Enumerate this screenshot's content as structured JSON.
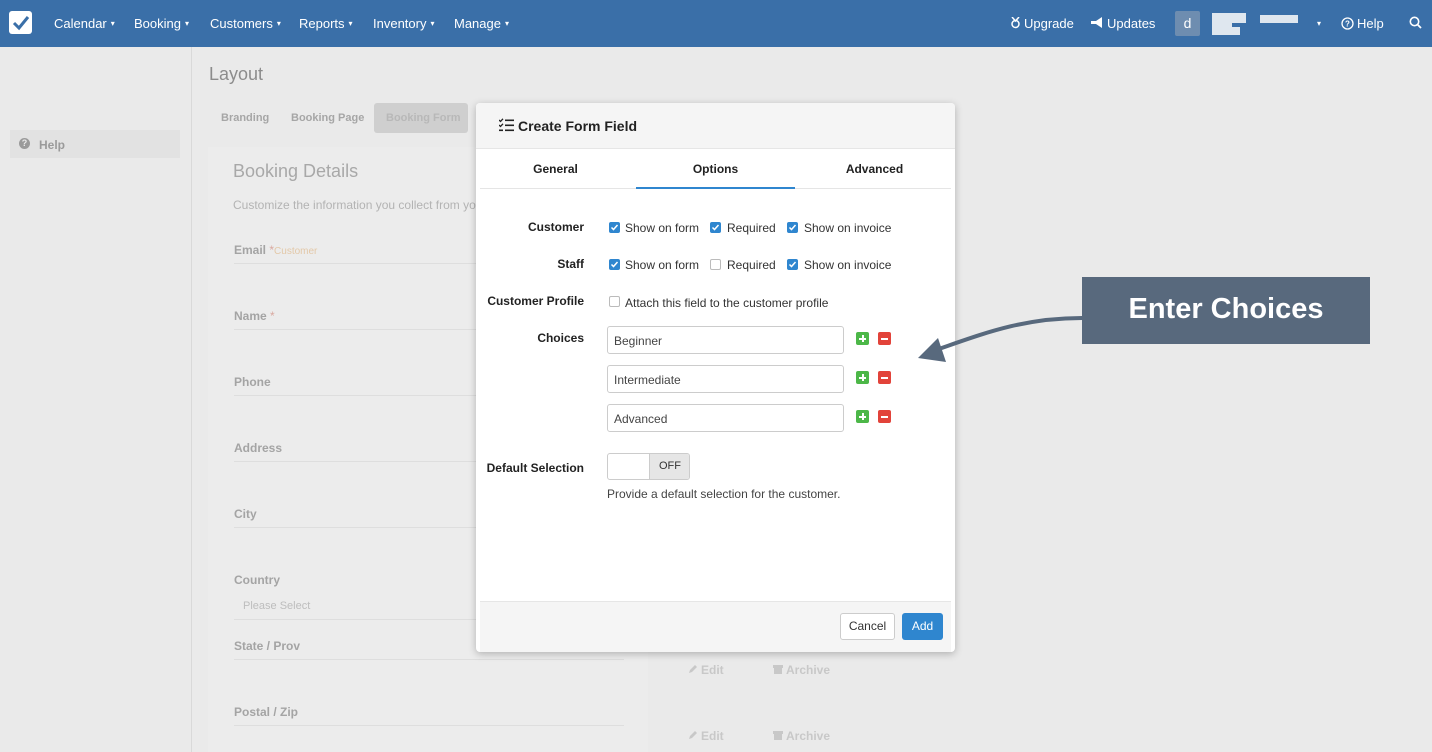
{
  "nav": {
    "items": [
      "Calendar",
      "Booking",
      "Customers",
      "Reports",
      "Inventory",
      "Manage"
    ],
    "upgrade": "Upgrade",
    "updates": "Updates",
    "avatar_letter": "d",
    "help": "Help",
    "caret": "▾"
  },
  "sidebar": {
    "help": "Help"
  },
  "page": {
    "title": "Layout",
    "tabs": [
      "Branding",
      "Booking Page",
      "Booking Form"
    ],
    "panel_title": "Booking Details",
    "panel_desc": "Customize the information you collect from you",
    "fields": [
      "Email",
      "Name",
      "Phone",
      "Address",
      "City",
      "Country",
      "State / Prov",
      "Postal / Zip"
    ],
    "required_mark": "*",
    "customer_tag": "Customer",
    "country_placeholder": "Please Select",
    "edit": "Edit",
    "archive": "Archive"
  },
  "modal": {
    "title": "Create Form Field",
    "tabs": [
      "General",
      "Options",
      "Advanced"
    ],
    "active_tab": "Options",
    "customer_label": "Customer",
    "staff_label": "Staff",
    "profile_label": "Customer Profile",
    "choices_label": "Choices",
    "default_label": "Default Selection",
    "show_on_form": "Show on form",
    "required": "Required",
    "show_on_invoice": "Show on invoice",
    "attach_profile": "Attach this field to the customer profile",
    "choices": [
      "Beginner",
      "Intermediate",
      "Advanced"
    ],
    "toggle_state": "OFF",
    "default_hint": "Provide a default selection for the customer.",
    "cancel": "Cancel",
    "add": "Add",
    "checks": {
      "customer": {
        "show_on_form": true,
        "required": true,
        "show_on_invoice": true
      },
      "staff": {
        "show_on_form": true,
        "required": false,
        "show_on_invoice": true
      },
      "attach_profile": false
    }
  },
  "callout": {
    "text": "Enter Choices"
  },
  "colors": {
    "nav_bg": "#3a6fa8",
    "accent": "#2f86cf",
    "add_green": "#4cb748",
    "remove_red": "#e2433a",
    "callout_bg": "#58697d"
  }
}
